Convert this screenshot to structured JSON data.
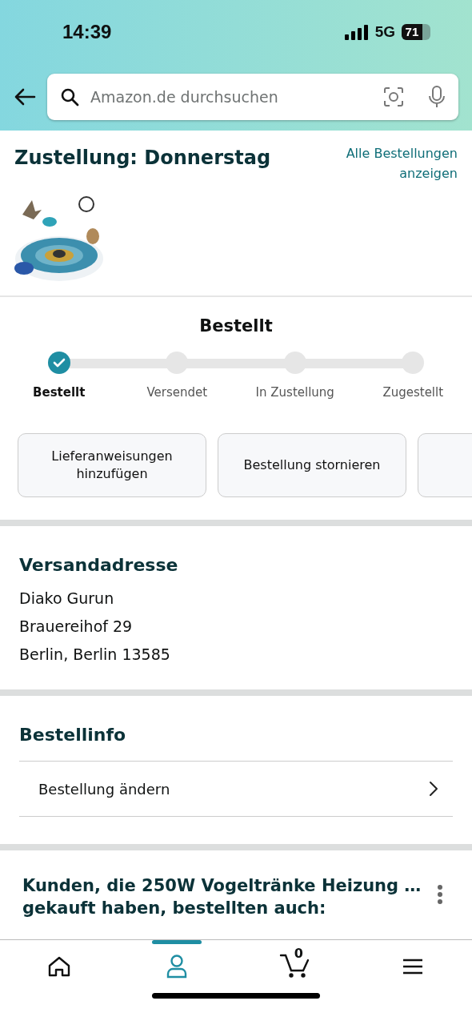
{
  "status_bar": {
    "time": "14:39",
    "network": "5G",
    "battery": "71"
  },
  "search": {
    "placeholder": "Amazon.de durchsuchen"
  },
  "delivery": {
    "title": "Zustellung: Donnerstag",
    "link": "Alle Bestellungen anzeigen"
  },
  "tracker": {
    "title": "Bestellt",
    "steps": [
      {
        "label": "Bestellt",
        "done": true,
        "selected": true
      },
      {
        "label": "Versendet",
        "done": false,
        "selected": false
      },
      {
        "label": "In Zustellung",
        "done": false,
        "selected": false
      },
      {
        "label": "Zugestellt",
        "done": false,
        "selected": false
      }
    ]
  },
  "actions": [
    "Lieferanweisungen hinzufügen",
    "Bestellung stornieren"
  ],
  "address": {
    "title": "Versandadresse",
    "lines": [
      "Diako Gurun",
      "Brauereihof 29",
      "Berlin, Berlin 13585"
    ]
  },
  "order_info": {
    "title": "Bestellinfo",
    "items": [
      "Bestellung ändern"
    ]
  },
  "recommendations": {
    "title": "Kunden, die 250W Vogeltränke Heizung … gekauft haben, bestellten auch:"
  },
  "nav": [
    {
      "kind": "home",
      "selected": false
    },
    {
      "kind": "account",
      "selected": true
    },
    {
      "kind": "cart",
      "count": "0",
      "selected": false
    },
    {
      "kind": "menu",
      "selected": false
    }
  ]
}
